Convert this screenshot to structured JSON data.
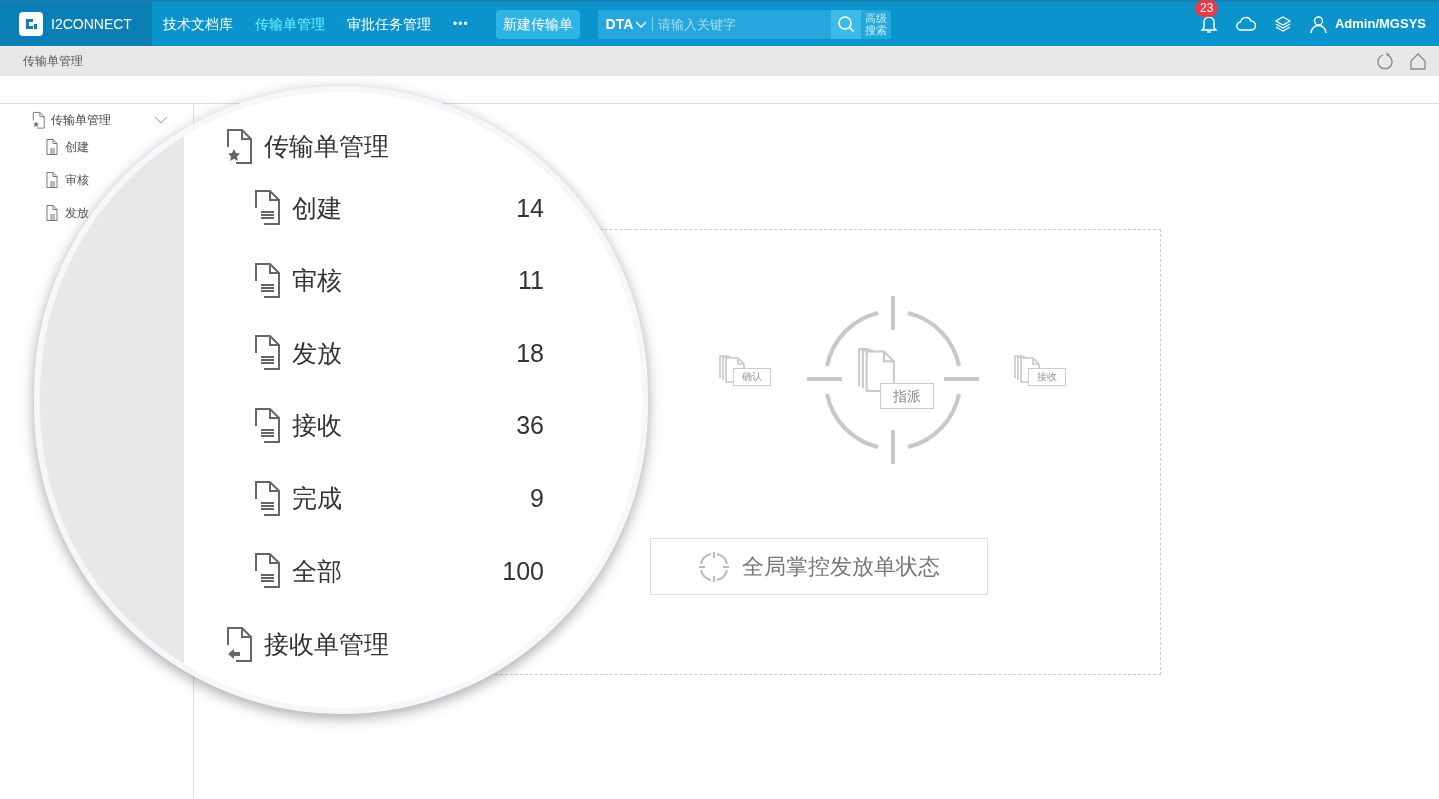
{
  "app": {
    "name": "I2CONNECT"
  },
  "nav": [
    {
      "label": "技术文档库",
      "selected": false
    },
    {
      "label": "传输单管理",
      "selected": true
    },
    {
      "label": "审批任务管理",
      "selected": false
    }
  ],
  "nav_more": "•••",
  "new_button": "新建传输单",
  "search": {
    "scope": "DTA",
    "placeholder": "请输入关键字",
    "advanced": "高级搜索"
  },
  "notifications": "23",
  "user": "Admin/MGSYS",
  "breadcrumb": "传输单管理",
  "sidebar": {
    "title": "传输单管理",
    "expanded": true,
    "items": [
      "创建",
      "审核",
      "发放"
    ]
  },
  "magnifier": {
    "groups": [
      {
        "title": "传输单管理",
        "kind": "outgoing",
        "items": [
          {
            "label": "创建",
            "count": "14"
          },
          {
            "label": "审核",
            "count": "11"
          },
          {
            "label": "发放",
            "count": "18"
          },
          {
            "label": "接收",
            "count": "36"
          },
          {
            "label": "完成",
            "count": "9"
          },
          {
            "label": "全部",
            "count": "100"
          }
        ]
      },
      {
        "title": "接收单管理",
        "kind": "incoming"
      }
    ]
  },
  "diagram": {
    "left": "确认",
    "center": "指派",
    "right": "接收"
  },
  "action_button": "全局掌控发放单状态"
}
